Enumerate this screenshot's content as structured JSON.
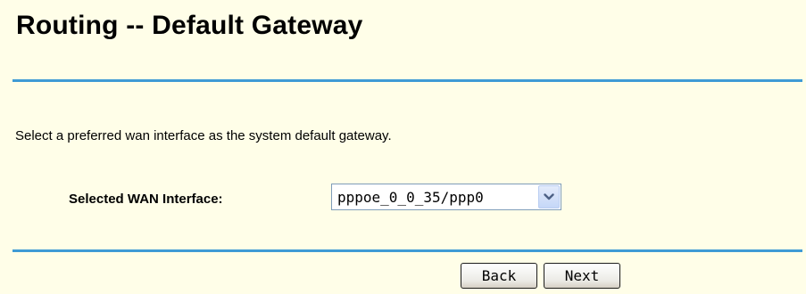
{
  "page": {
    "title": "Routing -- Default Gateway",
    "instruction": "Select a preferred wan interface as the system default gateway."
  },
  "wan_interface": {
    "label": "Selected WAN Interface:",
    "selected_value": "pppoe_0_0_35/ppp0"
  },
  "buttons": {
    "back_label": "Back",
    "next_label": "Next"
  },
  "colors": {
    "background": "#fffee8",
    "rule": "#3f9bd5",
    "dropdown_arrow": "#4d6185"
  },
  "icons": {
    "dropdown": "chevron-down-icon"
  }
}
